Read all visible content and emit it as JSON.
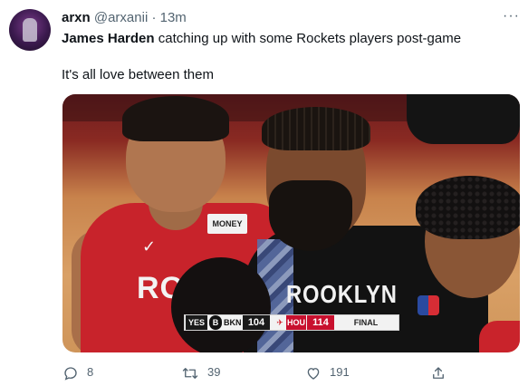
{
  "tweet": {
    "display_name": "arxn",
    "handle": "@arxanii",
    "separator": "·",
    "time": "13m",
    "more": "···",
    "text_bold": "James Harden",
    "text_rest": " catching up with some Rockets players post-game",
    "text_line2": "It's all love between them"
  },
  "media": {
    "jersey_left_text": "ROC",
    "jersey_patch": "MONEY",
    "jersey_right_text": "ROOKLYN",
    "scoreboard": {
      "network": "YES",
      "team1": "BKN",
      "team1_score": "104",
      "team2": "HOU",
      "team2_score": "114",
      "status": "FINAL"
    }
  },
  "actions": {
    "replies": "8",
    "retweets": "39",
    "likes": "191"
  },
  "colors": {
    "text": "#0f1419",
    "secondary": "#536471",
    "rockets_red": "#c8102e"
  },
  "icons": [
    "reply-icon",
    "retweet-icon",
    "like-icon",
    "share-icon",
    "more-icon"
  ]
}
